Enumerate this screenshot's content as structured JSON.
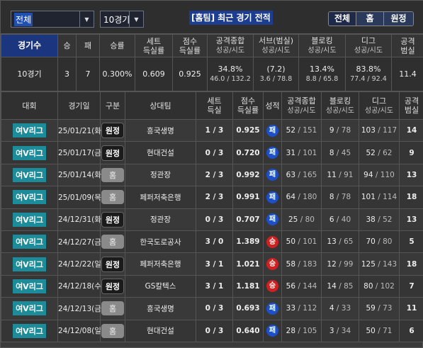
{
  "filters": {
    "scope_value": "전체",
    "count_value": "10경기",
    "title": "[홈팀] 최근 경기 전적",
    "segments": [
      "전체",
      "홈",
      "원정"
    ]
  },
  "summary": {
    "headers": [
      {
        "main": "경기수",
        "sub": ""
      },
      {
        "main": "승",
        "sub": ""
      },
      {
        "main": "패",
        "sub": ""
      },
      {
        "main": "승률",
        "sub": ""
      },
      {
        "main": "세트",
        "sub": "득실률"
      },
      {
        "main": "점수",
        "sub": "득실률"
      },
      {
        "main": "공격종합",
        "sub": "성공/시도"
      },
      {
        "main": "서브(범실)",
        "sub": "성공/시도"
      },
      {
        "main": "블로킹",
        "sub": "성공/시도"
      },
      {
        "main": "디그",
        "sub": "성공/시도"
      },
      {
        "main": "공격",
        "sub": "범실"
      }
    ],
    "row": {
      "games": "10경기",
      "wins": "3",
      "losses": "7",
      "win_rate": "0.300%",
      "set_ratio": "0.609",
      "point_ratio": "0.925",
      "attack_pct": "34.8%",
      "attack_frac": "46.0 / 132.2",
      "serve_pct": "(7.2)",
      "serve_frac": "3.6 / 78.8",
      "block_pct": "13.4%",
      "block_frac": "8.8 / 65.8",
      "dig_pct": "83.8%",
      "dig_frac": "77.4 / 92.4",
      "attack_err": "11.4"
    }
  },
  "table": {
    "headers": [
      {
        "main": "대회",
        "sub": ""
      },
      {
        "main": "경기일",
        "sub": ""
      },
      {
        "main": "구분",
        "sub": ""
      },
      {
        "main": "상대팀",
        "sub": ""
      },
      {
        "main": "세트",
        "sub": "득실"
      },
      {
        "main": "점수",
        "sub": "득실률"
      },
      {
        "main": "성적",
        "sub": ""
      },
      {
        "main": "공격종합",
        "sub": "성공/시도"
      },
      {
        "main": "블로킹",
        "sub": "성공/시도"
      },
      {
        "main": "디그",
        "sub": "성공/시도"
      },
      {
        "main": "공격",
        "sub": "범실"
      }
    ],
    "rows": [
      {
        "league": "여V리그",
        "date": "25/01/21(화)",
        "venue": "원정",
        "venue_type": "away",
        "opponent": "흥국생명",
        "sets": "1 / 3",
        "ratio": "0.925",
        "result": "패",
        "result_type": "lose",
        "atk_s": "52",
        "atk_t": "151",
        "blk_s": "9",
        "blk_t": "78",
        "dig_s": "103",
        "dig_t": "117",
        "err": "14"
      },
      {
        "league": "여V리그",
        "date": "25/01/17(금)",
        "venue": "원정",
        "venue_type": "away",
        "opponent": "현대건설",
        "sets": "0 / 3",
        "ratio": "0.720",
        "result": "패",
        "result_type": "lose",
        "atk_s": "31",
        "atk_t": "101",
        "blk_s": "8",
        "blk_t": "45",
        "dig_s": "52",
        "dig_t": "62",
        "err": "9"
      },
      {
        "league": "여V리그",
        "date": "25/01/14(화)",
        "venue": "홈",
        "venue_type": "home",
        "opponent": "정관장",
        "sets": "2 / 3",
        "ratio": "0.992",
        "result": "패",
        "result_type": "lose",
        "atk_s": "63",
        "atk_t": "165",
        "blk_s": "11",
        "blk_t": "91",
        "dig_s": "94",
        "dig_t": "110",
        "err": "13"
      },
      {
        "league": "여V리그",
        "date": "25/01/09(목)",
        "venue": "홈",
        "venue_type": "home",
        "opponent": "페퍼저축은행",
        "sets": "2 / 3",
        "ratio": "0.991",
        "result": "패",
        "result_type": "lose",
        "atk_s": "64",
        "atk_t": "180",
        "blk_s": "8",
        "blk_t": "78",
        "dig_s": "101",
        "dig_t": "114",
        "err": "18"
      },
      {
        "league": "여V리그",
        "date": "24/12/31(화)",
        "venue": "원정",
        "venue_type": "away",
        "opponent": "정관장",
        "sets": "0 / 3",
        "ratio": "0.707",
        "result": "패",
        "result_type": "lose",
        "atk_s": "25",
        "atk_t": "80",
        "blk_s": "6",
        "blk_t": "40",
        "dig_s": "38",
        "dig_t": "52",
        "err": "13"
      },
      {
        "league": "여V리그",
        "date": "24/12/27(금)",
        "venue": "홈",
        "venue_type": "home",
        "opponent": "한국도로공사",
        "sets": "3 / 0",
        "ratio": "1.389",
        "result": "승",
        "result_type": "win",
        "atk_s": "50",
        "atk_t": "101",
        "blk_s": "13",
        "blk_t": "65",
        "dig_s": "70",
        "dig_t": "80",
        "err": "5"
      },
      {
        "league": "여V리그",
        "date": "24/12/22(일)",
        "venue": "원정",
        "venue_type": "away",
        "opponent": "페퍼저축은행",
        "sets": "3 / 1",
        "ratio": "1.021",
        "result": "승",
        "result_type": "win",
        "atk_s": "58",
        "atk_t": "183",
        "blk_s": "12",
        "blk_t": "99",
        "dig_s": "125",
        "dig_t": "143",
        "err": "18"
      },
      {
        "league": "여V리그",
        "date": "24/12/18(수)",
        "venue": "원정",
        "venue_type": "away",
        "opponent": "GS칼텍스",
        "sets": "3 / 1",
        "ratio": "1.181",
        "result": "승",
        "result_type": "win",
        "atk_s": "56",
        "atk_t": "144",
        "blk_s": "14",
        "blk_t": "85",
        "dig_s": "80",
        "dig_t": "102",
        "err": "7"
      },
      {
        "league": "여V리그",
        "date": "24/12/13(금)",
        "venue": "홈",
        "venue_type": "home",
        "opponent": "흥국생명",
        "sets": "0 / 3",
        "ratio": "0.693",
        "result": "패",
        "result_type": "lose",
        "atk_s": "33",
        "atk_t": "112",
        "blk_s": "4",
        "blk_t": "33",
        "dig_s": "59",
        "dig_t": "73",
        "err": "11"
      },
      {
        "league": "여V리그",
        "date": "24/12/08(일)",
        "venue": "홈",
        "venue_type": "home",
        "opponent": "현대건설",
        "sets": "0 / 3",
        "ratio": "0.640",
        "result": "패",
        "result_type": "lose",
        "atk_s": "28",
        "atk_t": "105",
        "blk_s": "3",
        "blk_t": "34",
        "dig_s": "50",
        "dig_t": "71",
        "err": "6"
      }
    ]
  },
  "colors": {
    "league_badge": "#1d8c9a",
    "win": "#d12020",
    "lose": "#1d4fc9",
    "highlight": "#1b357e"
  }
}
